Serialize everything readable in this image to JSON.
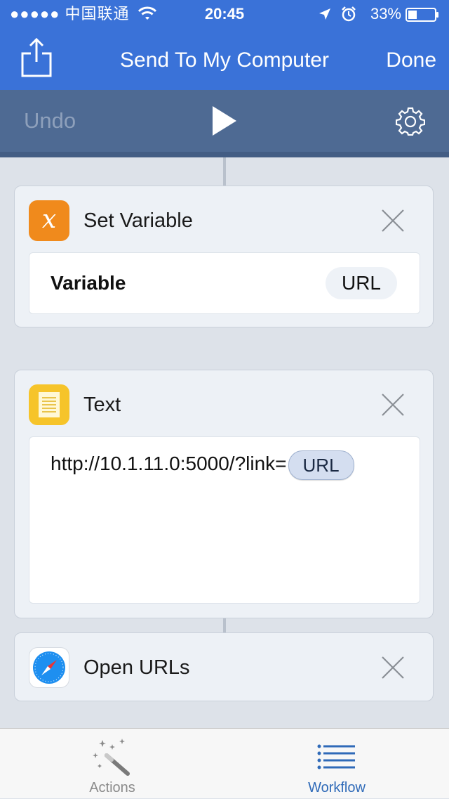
{
  "status_bar": {
    "carrier": "●●●●● 中国联通",
    "time": "20:45",
    "battery_percent": "33%"
  },
  "nav": {
    "title": "Send To My Computer",
    "done_label": "Done"
  },
  "toolbar": {
    "undo_label": "Undo"
  },
  "actions": [
    {
      "title": "Set Variable",
      "icon": "variable-icon",
      "icon_glyph": "x",
      "field_label": "Variable",
      "field_value": "URL"
    },
    {
      "title": "Text",
      "icon": "notes-icon",
      "text_value": "http://10.1.11.0:5000/?link=",
      "token": "URL"
    },
    {
      "title": "Open URLs",
      "icon": "safari-icon"
    }
  ],
  "tabbar": {
    "tabs": [
      {
        "label": "Actions",
        "icon": "magic-wand-icon",
        "selected": false
      },
      {
        "label": "Workflow",
        "icon": "list-icon",
        "selected": true
      }
    ]
  },
  "colors": {
    "header": "#3a72d8",
    "toolbar": "#4e6a93",
    "background": "#dde2e9",
    "tab_selected": "#2f6ab8",
    "tab_unselected": "#8a8a8a",
    "variable_icon": "#f08a1c",
    "notes_icon": "#f6c42a"
  }
}
